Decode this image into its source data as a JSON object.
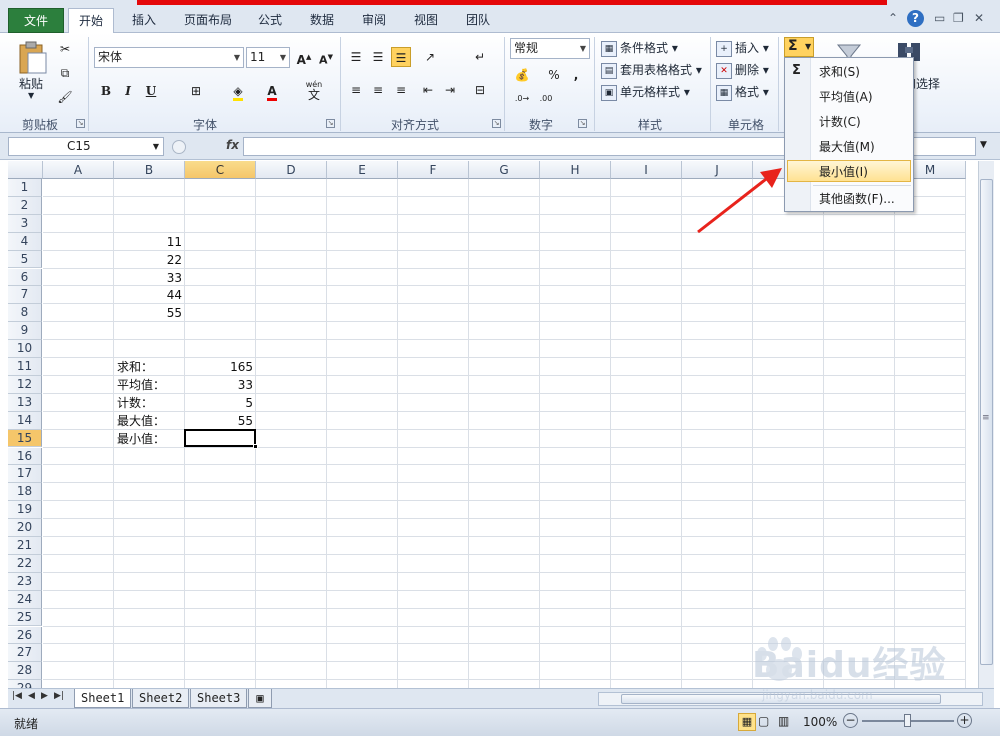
{
  "tabs": [
    "文件",
    "开始",
    "插入",
    "页面布局",
    "公式",
    "数据",
    "审阅",
    "视图",
    "团队"
  ],
  "active_tab": "开始",
  "ribbon": {
    "clipboard": {
      "paste_label": "粘贴",
      "group_label": "剪贴板"
    },
    "font": {
      "name": "宋体",
      "size": "11",
      "group_label": "字体",
      "bold": "B",
      "italic": "I",
      "underline": "U",
      "phonetic": "wén",
      "phonetic_char": "文"
    },
    "align": {
      "group_label": "对齐方式"
    },
    "number": {
      "format": "常规",
      "percent": "%",
      "comma": ",",
      "group_label": "数字"
    },
    "styles": {
      "conditional": "条件格式",
      "table": "套用表格格式",
      "cell": "单元格样式",
      "group_label": "样式"
    },
    "cells": {
      "insert": "插入",
      "delete": "删除",
      "format": "格式",
      "group_label": "单元格"
    },
    "editing": {
      "sigma": "Σ",
      "find_select": "查找和选择"
    }
  },
  "formula_bar": {
    "name_box": "C15",
    "fx": "fx",
    "value": ""
  },
  "columns": [
    "A",
    "B",
    "C",
    "D",
    "E",
    "F",
    "G",
    "H",
    "I",
    "J",
    "K",
    "L",
    "M"
  ],
  "selected_column": "C",
  "rows": [
    "1",
    "2",
    "3",
    "4",
    "5",
    "6",
    "7",
    "8",
    "9",
    "10",
    "11",
    "12",
    "13",
    "14",
    "15",
    "16",
    "17",
    "18",
    "19",
    "20",
    "21",
    "22",
    "23",
    "24",
    "25",
    "26",
    "27",
    "28",
    "29"
  ],
  "selected_row": "15",
  "cells": {
    "B4": "11",
    "B5": "22",
    "B6": "33",
    "B7": "44",
    "B8": "55",
    "B11": "求和：",
    "C11": "165",
    "B12": "平均值：",
    "C12": "33",
    "B13": "计数：",
    "C13": "5",
    "B14": "最大值：",
    "C14": "55",
    "B15": "最小值："
  },
  "active_cell": "C15",
  "autosum_menu": {
    "items": [
      "求和(S)",
      "平均值(A)",
      "计数(C)",
      "最大值(M)",
      "最小值(I)",
      "其他函数(F)..."
    ],
    "highlighted": "最小值(I)"
  },
  "sheets": [
    "Sheet1",
    "Sheet2",
    "Sheet3"
  ],
  "active_sheet": "Sheet1",
  "status": {
    "ready": "就绪",
    "zoom": "100%"
  },
  "watermark": {
    "brand": "Baidu经验",
    "url": "jingyan.baidu.com"
  },
  "colors": {
    "accent": "#2c7f3d",
    "highlight": "#ffd25f",
    "arrow": "#e8231c"
  }
}
